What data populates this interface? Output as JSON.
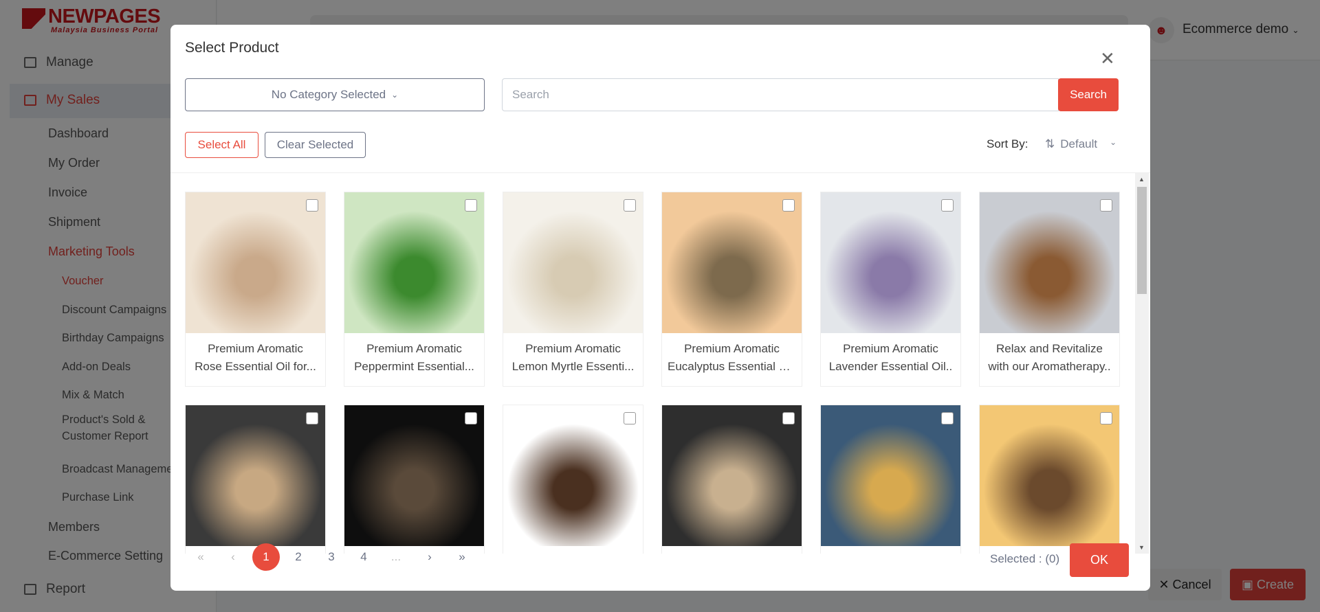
{
  "brand": {
    "name": "NEWPAGES",
    "tagline": "Malaysia Business Portal"
  },
  "sidebar": {
    "manage": "Manage",
    "my_sales": "My Sales",
    "items": [
      "Dashboard",
      "My Order",
      "Invoice",
      "Shipment"
    ],
    "marketing": "Marketing Tools",
    "marketing_items": [
      "Voucher",
      "Discount Campaigns",
      "Birthday Campaigns",
      "Add-on Deals",
      "Mix & Match",
      "Product's Sold &",
      "Customer Report",
      "Broadcast Management",
      "Purchase Link"
    ],
    "members": "Members",
    "ecommerce": "E-Commerce Setting",
    "report": "Report"
  },
  "header": {
    "user": "Ecommerce demo"
  },
  "page_actions": {
    "cancel": "Cancel",
    "create": "Create"
  },
  "modal": {
    "title": "Select Product",
    "category": "No Category Selected",
    "search_placeholder": "Search",
    "search_value": "",
    "search_button": "Search",
    "select_all": "Select All",
    "clear_selected": "Clear Selected",
    "sort_label": "Sort By:",
    "sort_value": "Default",
    "products": [
      {
        "l1": "Premium Aromatic",
        "l2": "Rose Essential Oil for...",
        "c1": "#efe3d3",
        "c2": "#c9a98a"
      },
      {
        "l1": "Premium Aromatic",
        "l2": "Peppermint Essential...",
        "c1": "#cfe6c2",
        "c2": "#3c8a2e"
      },
      {
        "l1": "Premium Aromatic",
        "l2": "Lemon Myrtle Essenti...",
        "c1": "#f4f1ea",
        "c2": "#d7cbb3"
      },
      {
        "l1": "Premium Aromatic",
        "l2": "Eucalyptus Essential O...",
        "c1": "#f2c99a",
        "c2": "#7d6a4d"
      },
      {
        "l1": "Premium Aromatic",
        "l2": "Lavender Essential Oil..",
        "c1": "#e3e6ea",
        "c2": "#8a7aa8"
      },
      {
        "l1": "Relax and Revitalize",
        "l2": "with our Aromatherapy..",
        "c1": "#c9ccd2",
        "c2": "#8a5a33"
      },
      {
        "l1": "",
        "l2": "",
        "c1": "#3a3a3a",
        "c2": "#c7a882"
      },
      {
        "l1": "",
        "l2": "",
        "c1": "#0e0e0e",
        "c2": "#5a4a3a"
      },
      {
        "l1": "",
        "l2": "",
        "c1": "#ffffff",
        "c2": "#4a3020"
      },
      {
        "l1": "",
        "l2": "",
        "c1": "#2e2e2e",
        "c2": "#c8b08f"
      },
      {
        "l1": "",
        "l2": "",
        "c1": "#3b5a78",
        "c2": "#d7a94f"
      },
      {
        "l1": "",
        "l2": "",
        "c1": "#f3c774",
        "c2": "#6b4a2d"
      }
    ],
    "pagination": {
      "first": "«",
      "prev": "‹",
      "pages": [
        "1",
        "2",
        "3",
        "4"
      ],
      "ellipsis": "...",
      "next": "›",
      "last": "»",
      "current": "1"
    },
    "selected_text": "Selected : (0)",
    "ok": "OK"
  },
  "colors": {
    "accent": "#e84c3d",
    "brand": "#c8161d"
  }
}
